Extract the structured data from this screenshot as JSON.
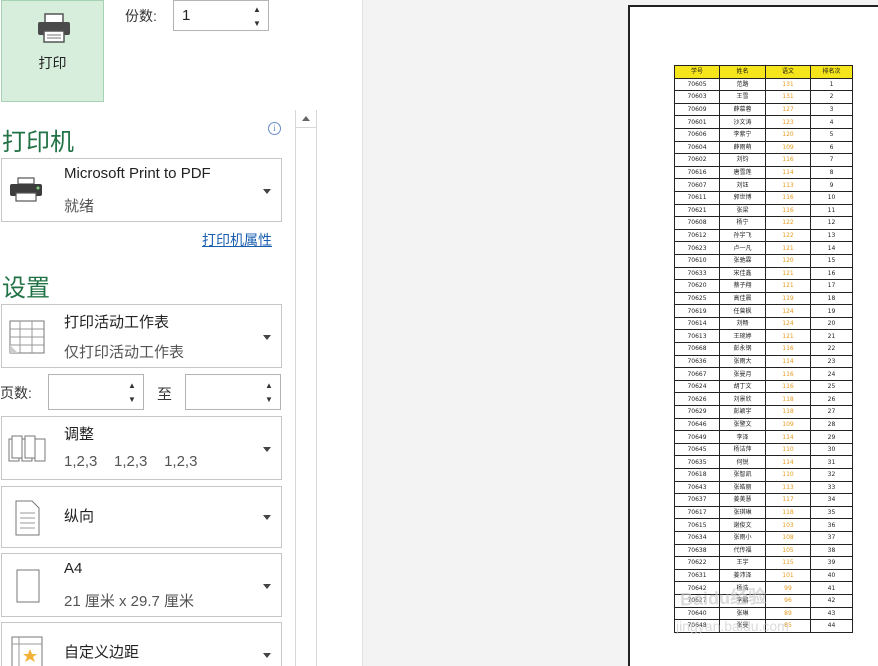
{
  "print": {
    "label": "打印"
  },
  "copies": {
    "label": "份数:",
    "value": "1"
  },
  "printer": {
    "section_title": "打印机",
    "info": "i",
    "name": "Microsoft Print to PDF",
    "status": "就绪",
    "properties_link": "打印机属性"
  },
  "settings": {
    "section_title": "设置",
    "what": {
      "title": "打印活动工作表",
      "sub": "仅打印活动工作表"
    },
    "pages_label": "页数:",
    "to_label": "至",
    "collate": {
      "title": "调整",
      "sub": "1,2,3    1,2,3    1,2,3"
    },
    "orientation": {
      "title": "纵向"
    },
    "paper": {
      "title": "A4",
      "sub": "21 厘米 x 29.7 厘米"
    },
    "margins": {
      "title": "自定义边距"
    }
  },
  "sheet": {
    "headers": [
      "学号",
      "姓名",
      "语文",
      "排名次"
    ],
    "rows": [
      [
        "70605",
        "范路",
        "131",
        "1"
      ],
      [
        "70603",
        "王雪",
        "131",
        "2"
      ],
      [
        "70609",
        "薛慕蓉",
        "127",
        "3"
      ],
      [
        "70601",
        "沙文涛",
        "123",
        "4"
      ],
      [
        "70606",
        "李紫宁",
        "120",
        "5"
      ],
      [
        "70604",
        "薛雨萌",
        "109",
        "6"
      ],
      [
        "70602",
        "刘钧",
        "116",
        "7"
      ],
      [
        "70616",
        "唐雪莲",
        "114",
        "8"
      ],
      [
        "70607",
        "刘钰",
        "113",
        "9"
      ],
      [
        "70611",
        "郭世博",
        "116",
        "10"
      ],
      [
        "70621",
        "张梁",
        "116",
        "11"
      ],
      [
        "70608",
        "杨宁",
        "122",
        "12"
      ],
      [
        "70612",
        "孙宇飞",
        "122",
        "13"
      ],
      [
        "70623",
        "卢一凡",
        "121",
        "14"
      ],
      [
        "70610",
        "张驰霖",
        "120",
        "15"
      ],
      [
        "70633",
        "宋佳鑫",
        "121",
        "16"
      ],
      [
        "70620",
        "蔡子翔",
        "121",
        "17"
      ],
      [
        "70625",
        "高佳晨",
        "119",
        "18"
      ],
      [
        "70619",
        "任曾枫",
        "124",
        "19"
      ],
      [
        "70614",
        "刘畅",
        "124",
        "20"
      ],
      [
        "70613",
        "王琬婷",
        "121",
        "21"
      ],
      [
        "70668",
        "彭永钢",
        "116",
        "22"
      ],
      [
        "70636",
        "张雨大",
        "114",
        "23"
      ],
      [
        "70667",
        "张曼月",
        "116",
        "24"
      ],
      [
        "70624",
        "胡丁文",
        "116",
        "25"
      ],
      [
        "70626",
        "刘景欣",
        "118",
        "26"
      ],
      [
        "70629",
        "彭颖宇",
        "118",
        "27"
      ],
      [
        "70646",
        "张警文",
        "109",
        "28"
      ],
      [
        "70649",
        "李泽",
        "114",
        "29"
      ],
      [
        "70645",
        "杨洁萍",
        "110",
        "30"
      ],
      [
        "70635",
        "何锐",
        "114",
        "31"
      ],
      [
        "70618",
        "张智凯",
        "110",
        "32"
      ],
      [
        "70643",
        "张皓丽",
        "113",
        "33"
      ],
      [
        "70637",
        "姜美慧",
        "117",
        "34"
      ],
      [
        "70617",
        "张琪琳",
        "118",
        "35"
      ],
      [
        "70615",
        "谢俊文",
        "103",
        "36"
      ],
      [
        "70634",
        "张雨小",
        "108",
        "37"
      ],
      [
        "70638",
        "代传福",
        "105",
        "38"
      ],
      [
        "70622",
        "王宇",
        "115",
        "39"
      ],
      [
        "70631",
        "姜沛泽",
        "101",
        "40"
      ],
      [
        "70642",
        "杨浩",
        "99",
        "41"
      ],
      [
        "70627",
        "李鹏",
        "96",
        "42"
      ],
      [
        "70640",
        "张琳",
        "89",
        "43"
      ],
      [
        "70648",
        "张曼",
        "85",
        "44"
      ]
    ]
  }
}
